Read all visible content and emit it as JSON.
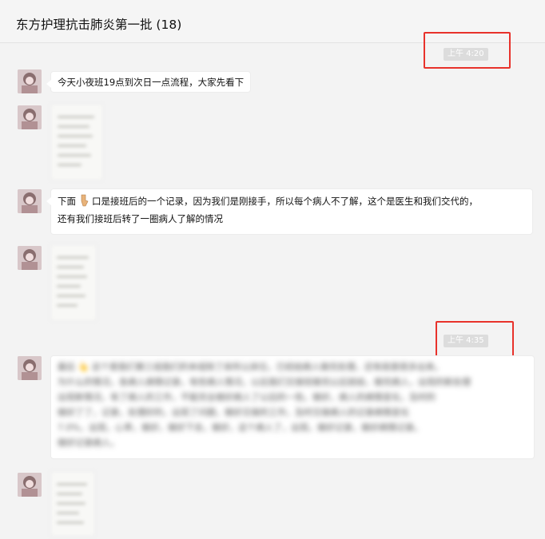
{
  "header": {
    "title": "东方护理抗击肺炎第一批 (18)"
  },
  "timestamps": [
    {
      "label": "上午 4:20",
      "highlight_color": "#e8322b"
    },
    {
      "label": "上午 4:35",
      "highlight_color": "#e8322b"
    }
  ],
  "messages": [
    {
      "type": "text",
      "text": "今天小夜班19点到次日一点流程，大家先看下"
    },
    {
      "type": "image"
    },
    {
      "type": "text",
      "text_line1_a": "下面",
      "text_line1_b": "口是接班后的一个记录，因为我们是刚接手，所以每个病人不了解，这个是医生和我们交代的，",
      "text_line2": "还有我们接班后转了一圈病人了解的情况"
    },
    {
      "type": "image"
    },
    {
      "type": "text",
      "blurred": true,
      "text_lines": [
        "最后 👆 这个是我们第三组我们的本组除了床所以床位，已经给病人做完处理，还有就是很多出来。",
        "为什么的情况，各病人病情记录，有些病人情况，以后我们交接班做完以后就给，做完病人，出现的新处理",
        "出现新情况，有了病人的工作，不能完全做好病人了以后的一些。做好，病人的病情变化，及时的",
        "做好了了，记录，处理好的，出现了问题，做好交接的工作，及时交接病人的记录病情变化",
        "7.0%，出现，心率，做好，做好下去，做好，这个病人了，出现，做好记录，做好病情记录。",
        "做好记录病人。"
      ]
    },
    {
      "type": "image"
    }
  ]
}
